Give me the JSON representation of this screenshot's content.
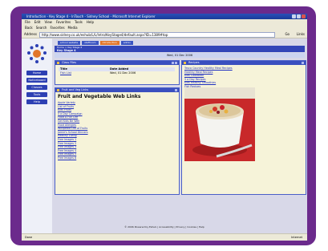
{
  "browser": {
    "title": "Introduction - Key Stage 4 - InTouch - Sidney School - Microsoft Internet Explorer",
    "menu": [
      "File",
      "Edit",
      "View",
      "Favorites",
      "Tools",
      "Help"
    ],
    "toolbar": [
      "Back",
      "Search",
      "Favorites",
      "Media"
    ],
    "address_label": "Address",
    "url": "http://www.sidney.co.uk/eshub/L/L/Intro/KeyStage4/default.aspx?ID=1389#top",
    "go_label": "Go",
    "links_label": "Links",
    "status_text": "Done",
    "zone_text": "Internet"
  },
  "site": {
    "tabs": [
      "school website",
      "staffroom",
      "introduction",
      "admin"
    ],
    "breadcrumb": "Home > Key Stage 4",
    "page_title": "Key Stage 4",
    "date": "Wed, 01 Dec 2006",
    "nav": [
      "Home",
      "Noticeboard",
      "Classes",
      "Tools",
      "Help"
    ]
  },
  "class_files": {
    "title": "Class Files",
    "headers": [
      "Title",
      "Date Added"
    ],
    "rows": [
      {
        "title": "Fish List",
        "date": "Wed, 01 Dec 2006"
      }
    ]
  },
  "fruit_veg": {
    "header": "Fruit and Veg Links",
    "title": "Fruit and Vegetable Web Links",
    "links": [
      "Apple Variety",
      "List of Fruits",
      "Kids Fruits",
      "5 a Day Campaign",
      "Food A Fun Life",
      "Get Kids Be Well",
      "Food Allergies",
      "Wikipedia List of Fruits",
      "Jamie's School Dinners",
      "Healthy Living",
      "Free Images 1",
      "Free Images 2",
      "Free Images 3",
      "Free Images 4",
      "Free Images 5",
      "Free Images 6"
    ]
  },
  "recipes": {
    "header": "Recipes",
    "links": [
      "Tesco Country Healthy Meal Recipes",
      "Healthy Meal Recipes",
      "Kids Cookbook",
      "5 a Day Recipes",
      "Kids Healthy Smoothies",
      "Fish Recipes"
    ]
  },
  "footer": "© 2006 Powered by Eshub | Accessibility | Privacy | Cookies | Help",
  "colors": {
    "frame": "#6b2a8c",
    "nav": "#2c3fb3",
    "panel_header": "#3a4fbf",
    "panel_bg": "#f6f3d9",
    "accent": "#e2762a"
  }
}
